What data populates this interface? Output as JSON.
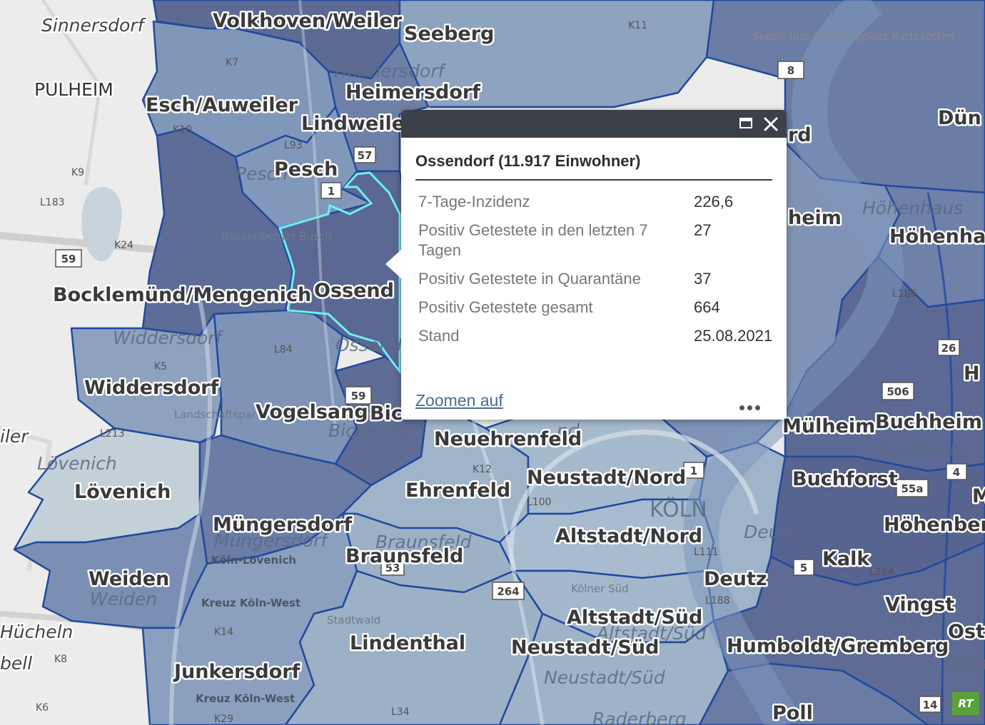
{
  "popup": {
    "title": "Ossendorf (11.917 Einwohner)",
    "rows": [
      {
        "label": "7-Tage-Inzidenz",
        "value": "226,6"
      },
      {
        "label": "Positiv Getestete in den letzten 7 Tagen",
        "value": "27"
      },
      {
        "label": "Positiv Getestete in Quarantäne",
        "value": "37"
      },
      {
        "label": "Positiv Getestete gesamt",
        "value": "664"
      },
      {
        "label": "Stand",
        "value": "25.08.2021"
      }
    ],
    "zoom_label": "Zoomen auf",
    "icons": {
      "maximize": "maximize-icon",
      "close": "close-icon",
      "more": "more-icon"
    }
  },
  "map": {
    "district_labels": {
      "volkhoven_weiler": "Volkhoven/Weiler",
      "seeberg": "Seeberg",
      "heimersdorf": "Heimersdorf",
      "esch_auweiler": "Esch/Auweiler",
      "lindweiler": "Lindweile",
      "pesch": "Pesch",
      "bocklemuend": "Bocklemünd/Mengenich",
      "ossendorf": "Ossend",
      "widdersdorf": "Widdersdorf",
      "vogelsang": "Vogelsang",
      "bickendorf": "Bic",
      "neuehrenfeld": "Neuehrenfeld",
      "loevenich": "Lövenich",
      "ehrenfeld": "Ehrenfeld",
      "neustadt_nord": "Neustadt/Nord",
      "muengersdorf": "Müngersdorf",
      "braunsfeld": "Braunsfeld",
      "altstadt_nord": "Altstadt/Nord",
      "weiden": "Weiden",
      "deutz": "Deutz",
      "altstadt_sued": "Altstadt/Süd",
      "lindenthal": "Lindenthal",
      "neustadt_sued": "Neustadt/Süd",
      "junkersdorf": "Junkersdorf",
      "humboldt_gremberg": "Humboldt/Gremberg",
      "kalk": "Kalk",
      "vingst": "Vingst",
      "buchforst": "Buchforst",
      "muelheim": "Mülheim",
      "buchheim": "Buchheim",
      "hoehenhaus": "Höhenha",
      "hoehenberg": "Höhenber",
      "poll": "Poll",
      "duen": "Dün",
      "heim": "heim",
      "rd": "rd",
      "sinnersdorf": "Sinnersdorf",
      "pulheim": "PULHEIM",
      "huecheln": "Hücheln",
      "iler": "iler",
      "bell": "bell",
      "ost": "Ost",
      "h_cut": "H",
      "m_cut": "M"
    },
    "base_labels": {
      "heimersdorf": "Heimersdorf",
      "pesch": "Pesch",
      "widdersdorf": "Widdersdorf",
      "lovenich": "Lövenich",
      "bickendorf": "Bickendorf",
      "mungersdorf": "Müngersdorf",
      "braunsfeld": "Braunsfeld",
      "weiden": "Weiden",
      "koln": "KÖLN",
      "deutz": "Deutz",
      "hohenhaus": "Höhenhaus",
      "buchheim": "Buchheim",
      "vingst": "Vingst",
      "altstadt_sud": "Altstadt/Süd",
      "neustadt_sud": "Neustadt/Süd",
      "ossendorf": "Ossend",
      "raderberg": "Raderberg",
      "ost": "Osth",
      "nd": "nd"
    },
    "place_labels": {
      "nussenberger_busch": "Nüssenberger Busch",
      "landschaftspark": "Landschaftspark Belvedere",
      "kreuz_koeln_west_1": "Kreuz Köln-West",
      "kreuz_koeln_west_2": "Kreuz Köln-West",
      "koeln_loevenich": "Köln-Lövenich",
      "stadtwald": "Stadtwald",
      "segelflug": "Segel- und Sportflugplatz Kurtekotten",
      "kreuz": "Kölner Süd"
    },
    "road_labels": [
      "K7",
      "K10",
      "L93",
      "K9",
      "L183",
      "K24",
      "K5",
      "L213",
      "L84",
      "K12",
      "L100",
      "L111",
      "L188",
      "L284",
      "K14",
      "K8",
      "K6",
      "K29",
      "L34",
      "K11",
      "L186"
    ],
    "shields": [
      "59",
      "59",
      "8",
      "1",
      "264",
      "506",
      "53",
      "55a",
      "26",
      "4",
      "14",
      "57",
      "1",
      "5"
    ],
    "watermark": "RT"
  }
}
